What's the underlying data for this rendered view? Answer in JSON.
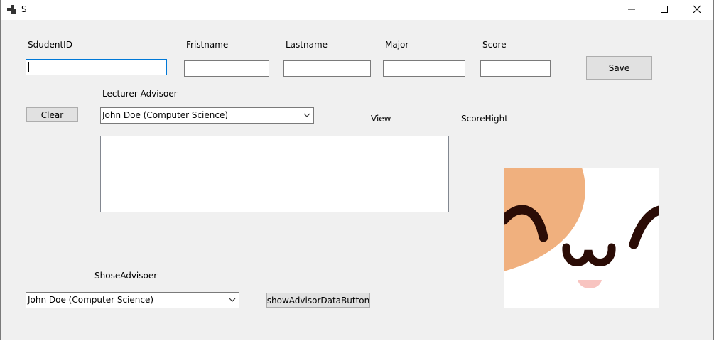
{
  "window": {
    "title": "S",
    "app_icon": "winforms-app-icon",
    "controls": {
      "minimize_icon": "minimize-icon",
      "maximize_icon": "maximize-icon",
      "close_icon": "close-icon"
    }
  },
  "form": {
    "labels": {
      "student_id": "SdudentID",
      "firstname": "Fristname",
      "lastname": "Lastname",
      "major": "Major",
      "score": "Score",
      "lecturer_advisor": "Lecturer Advisoer",
      "view": "View",
      "score_hight": "ScoreHight",
      "shose_advisor": "ShoseAdvisoer"
    },
    "fields": {
      "student_id": "",
      "firstname": "",
      "lastname": "",
      "major": "",
      "score": ""
    },
    "buttons": {
      "save": "Save",
      "clear": "Clear",
      "show_advisor_data": "showAdvisorDataButton"
    },
    "lecturer_advisor_combo": {
      "selected": "John Doe (Computer Science)"
    },
    "shose_advisor_combo": {
      "selected": "John Doe (Computer Science)"
    },
    "picture": {
      "icon": "cute-cat-face-icon",
      "colors": {
        "patch": "#f0b07e",
        "eyes": "#2b0c06",
        "tongue": "#f8c4c0"
      }
    }
  }
}
